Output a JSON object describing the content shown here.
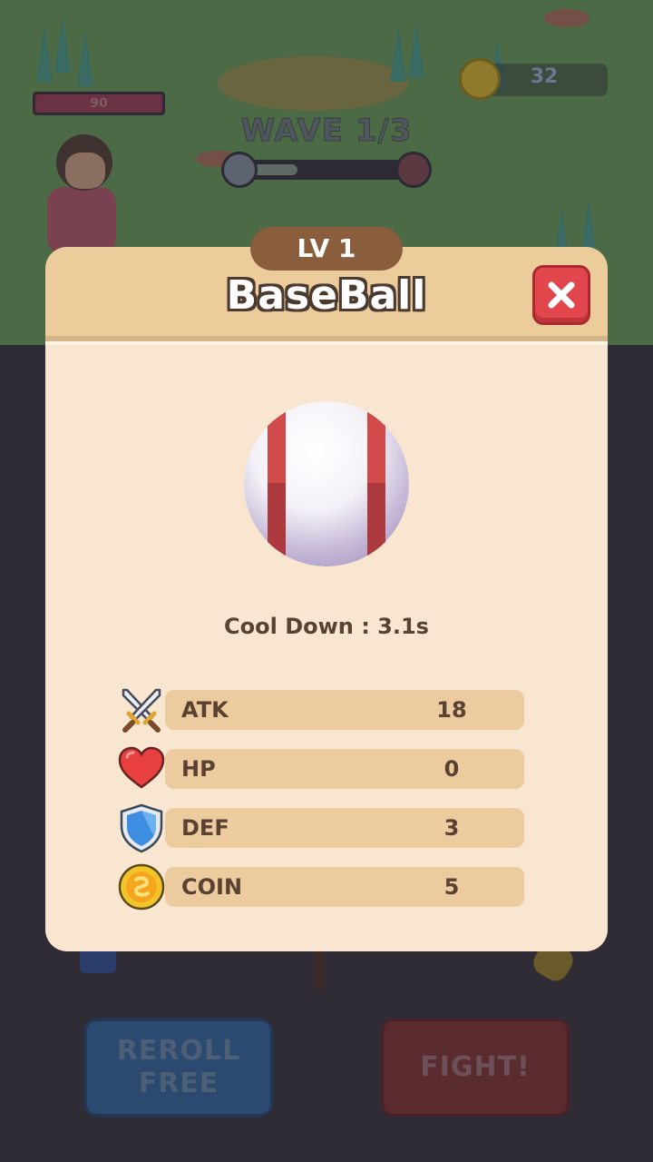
{
  "hud": {
    "player_hp": "90",
    "coins": "32",
    "wave_label": "WAVE 1/3",
    "wave_progress": 0.33
  },
  "buttons": {
    "reroll_line1": "REROLL",
    "reroll_line2": "FREE",
    "fight": "FIGHT!"
  },
  "item_popup": {
    "level": "LV 1",
    "name": "BaseBall",
    "cooldown": "Cool Down : 3.1s",
    "stats": [
      {
        "label": "ATK",
        "value": "18",
        "icon": "crossed-swords-icon"
      },
      {
        "label": "HP",
        "value": "0",
        "icon": "heart-icon"
      },
      {
        "label": "DEF",
        "value": "3",
        "icon": "shield-icon"
      },
      {
        "label": "COIN",
        "value": "5",
        "icon": "coin-icon"
      }
    ]
  },
  "colors": {
    "popup_bg": "#f8e6d0",
    "popup_header": "#edcc9c",
    "level_badge": "#8a5e3c",
    "close_button": "#e0464b",
    "stat_bar": "#eccc9e",
    "text_brown": "#5a4232"
  }
}
